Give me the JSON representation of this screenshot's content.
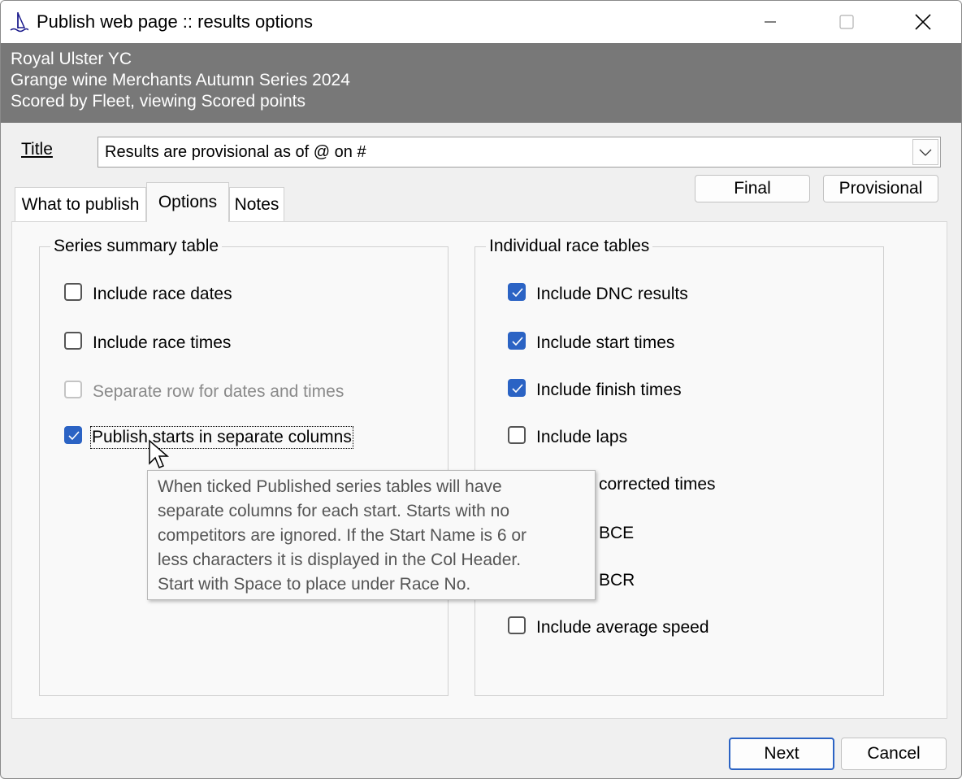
{
  "window": {
    "title": "Publish web page :: results options"
  },
  "banner": {
    "line1": "Royal Ulster YC",
    "line2": "Grange wine Merchants Autumn Series 2024",
    "line3": "Scored by Fleet, viewing Scored points"
  },
  "title_field": {
    "label": "Title",
    "value": "Results are provisional as of @ on #"
  },
  "buttons": {
    "final": "Final",
    "provisional": "Provisional",
    "next": "Next",
    "cancel": "Cancel"
  },
  "tabs": [
    {
      "label": "What to publish",
      "active": false
    },
    {
      "label": "Options",
      "active": true
    },
    {
      "label": "Notes",
      "active": false
    }
  ],
  "series_summary": {
    "legend": "Series summary table",
    "items": [
      {
        "label": "Include race dates",
        "checked": false,
        "enabled": true
      },
      {
        "label": "Include race times",
        "checked": false,
        "enabled": true
      },
      {
        "label": "Separate row for dates and times",
        "checked": false,
        "enabled": false
      },
      {
        "label": "Publish starts in separate columns",
        "checked": true,
        "enabled": true
      }
    ]
  },
  "individual_race": {
    "legend": "Individual race tables",
    "items": [
      {
        "label": "Include DNC results",
        "checked": true
      },
      {
        "label": "Include start times",
        "checked": true
      },
      {
        "label": "Include finish times",
        "checked": true
      },
      {
        "label": "Include laps",
        "checked": false
      },
      {
        "label": "corrected times",
        "checked": false
      },
      {
        "label": "BCE",
        "checked": false
      },
      {
        "label": "BCR",
        "checked": false
      },
      {
        "label": "Include average speed",
        "checked": false
      }
    ]
  },
  "tooltip": {
    "lines": [
      "When ticked Published series tables will have",
      "separate columns for each start. Starts with no",
      "competitors are ignored.  If the Start Name is 6 or",
      "less characters it is displayed in the Col Header.",
      "Start with Space to place under Race No."
    ]
  },
  "colors": {
    "banner": "#787878",
    "checkbox_checked": "#2b63c4",
    "default_button_border": "#2b63c4"
  },
  "icons": [
    "sailboat-icon",
    "minimize-icon",
    "maximize-icon",
    "close-icon",
    "chevron-down-icon",
    "checkmark-icon",
    "mouse-pointer-icon"
  ]
}
